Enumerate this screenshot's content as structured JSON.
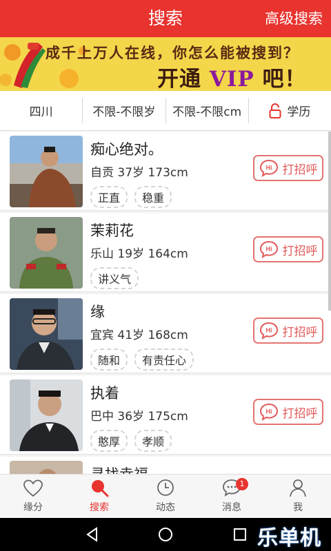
{
  "header": {
    "title": "搜索",
    "advanced_search": "高级搜索"
  },
  "banner": {
    "line1": "成千上万人在线，你怎么能被搜到？",
    "line2_prefix": "开通 ",
    "line2_vip": "VIP",
    "line2_suffix": " 吧！"
  },
  "filters": [
    {
      "label": "四川"
    },
    {
      "label": "不限-不限岁"
    },
    {
      "label": "不限-不限cm"
    },
    {
      "label": "学历"
    }
  ],
  "greet_label": "打招呼",
  "profiles": [
    {
      "name": "痴心绝对。",
      "city": "自贡",
      "age": "37岁",
      "height": "173cm",
      "tags": [
        "正直",
        "稳重"
      ]
    },
    {
      "name": "茉莉花",
      "city": "乐山",
      "age": "19岁",
      "height": "164cm",
      "tags": [
        "讲义气"
      ]
    },
    {
      "name": "缘",
      "city": "宜宾",
      "age": "41岁",
      "height": "168cm",
      "tags": [
        "随和",
        "有责任心"
      ]
    },
    {
      "name": "执着",
      "city": "巴中",
      "age": "36岁",
      "height": "175cm",
      "tags": [
        "憨厚",
        "孝顺"
      ]
    },
    {
      "name": "寻找幸福"
    }
  ],
  "tabs": [
    {
      "label": "缘分",
      "icon": "heart-icon"
    },
    {
      "label": "搜索",
      "icon": "search-icon"
    },
    {
      "label": "动态",
      "icon": "clock-icon"
    },
    {
      "label": "消息",
      "icon": "chat-icon",
      "badge": "1"
    },
    {
      "label": "我",
      "icon": "user-icon"
    }
  ],
  "watermark": "乐单机",
  "colors": {
    "primary": "#e8332f",
    "greet_border": "#e57372",
    "banner_bg": "#f4d64a"
  }
}
